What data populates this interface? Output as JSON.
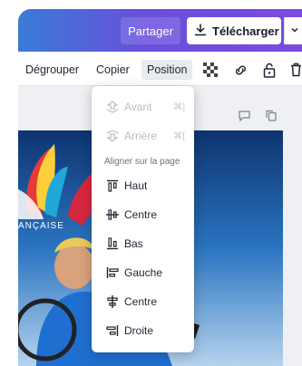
{
  "header": {
    "share_label": "Partager",
    "download_label": "Télécharger"
  },
  "toolbar": {
    "ungroup_label": "Dégrouper",
    "copy_label": "Copier",
    "position_label": "Position"
  },
  "canvas": {
    "photo_text": "ANÇAISE"
  },
  "position_menu": {
    "items_top": [
      {
        "label": "Avant",
        "shortcut": "⌘]",
        "icon": "bring-forward-icon",
        "disabled": true
      },
      {
        "label": "Arrière",
        "shortcut": "⌘[",
        "icon": "send-backward-icon",
        "disabled": true
      }
    ],
    "section_title": "Aligner sur la page",
    "align_items": [
      {
        "label": "Haut",
        "icon": "align-top-icon"
      },
      {
        "label": "Centre",
        "icon": "align-middle-icon"
      },
      {
        "label": "Bas",
        "icon": "align-bottom-icon"
      },
      {
        "label": "Gauche",
        "icon": "align-left-icon"
      },
      {
        "label": "Centre",
        "icon": "align-center-icon"
      },
      {
        "label": "Droite",
        "icon": "align-right-icon"
      }
    ]
  },
  "colors": {
    "gradient_start": "#3a7bd5",
    "gradient_end": "#7b4be0",
    "position_active_bg": "#e9ebef"
  }
}
